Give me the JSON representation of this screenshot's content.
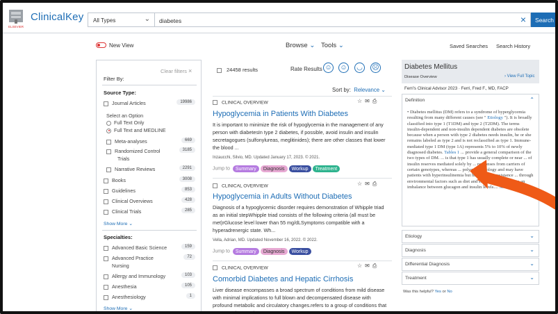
{
  "header": {
    "logo_text": "ClinicalKey",
    "logo_sub": "ELSEVIER",
    "type_select": "All Types",
    "search_value": "diabetes",
    "search_button": "Search"
  },
  "subnav": {
    "new_view": "New View",
    "browse": "Browse",
    "tools": "Tools",
    "saved_searches": "Saved Searches",
    "search_history": "Search History"
  },
  "filters": {
    "clear": "Clear filters",
    "filter_by": "Filter By:",
    "source_type_heading": "Source Type:",
    "journal": {
      "label": "Journal Articles",
      "count": "19986"
    },
    "select_option": "Select an Option",
    "radio_full_text": "Full Text Only",
    "radio_medline": "Full Text and MEDLINE",
    "meta": {
      "label": "Meta-analyses",
      "count": "669"
    },
    "rct_1": "Randomized Control",
    "rct_2": "Trials",
    "rct_count": "3185",
    "narrative": {
      "label": "Narrative Reviews",
      "count": "2291"
    },
    "books": {
      "label": "Books",
      "count": "3008"
    },
    "guidelines": {
      "label": "Guidelines",
      "count": "853"
    },
    "overviews": {
      "label": "Clinical Overviews",
      "count": "428"
    },
    "trials": {
      "label": "Clinical Trials",
      "count": "285"
    },
    "show_more": "Show More",
    "specialties_heading": "Specialties:",
    "abs": {
      "label": "Advanced Basic Science",
      "count": "159"
    },
    "practice_1": "Advanced Practice",
    "practice_2": "Nursing",
    "practice_count": "72",
    "allergy": {
      "label": "Allergy and Immunology",
      "count": "103"
    },
    "anesthesia": {
      "label": "Anesthesia",
      "count": "105"
    },
    "anesthesiology": {
      "label": "Anesthesiology",
      "count": "1"
    },
    "show_more_2": "Show More"
  },
  "results": {
    "count": "24458 results",
    "rate": "Rate Results",
    "sort_by": "Sort by:",
    "sort_value": "Relevance",
    "cards": [
      {
        "type": "CLINICAL OVERVIEW",
        "title": "Hypoglycemia in Patients With Diabetes",
        "text": "It is important to minimize the risk of hypoglycemia in the management of any person with diabetesIn type 2 diabetes, if possible, avoid insulin and insulin secretagogues (sulfonylureas, meglitinides); there are other classes that lower the blood ...",
        "meta": "Inzaucchi, Silvio, MD. Updated January 17, 2023. © 2021.",
        "jump": "Jump to",
        "pills": [
          "Summary",
          "Diagnosis",
          "Workup",
          "Treatment"
        ]
      },
      {
        "type": "CLINICAL OVERVIEW",
        "title": "Hypoglycemia in Adults Without Diabetes",
        "text": "Diagnosis of a hypoglycemic disorder requires demonstration of Whipple triad as an initial stepWhipple triad consists of the following criteria (all must be met)rGlucose level lower than 55 mg/dLSymptoms compatible with a hyperadrenergic state. Wh...",
        "meta": "Vella, Adrian, MD. Updated November 16, 2022. © 2022.",
        "jump": "Jump to",
        "pills": [
          "Summary",
          "Diagnosis",
          "Workup"
        ]
      },
      {
        "type": "CLINICAL OVERVIEW",
        "title": "Comorbid Diabetes and Hepatic Cirrhosis",
        "text": "Liver disease encompasses a broad spectrum of conditions from mild disease with minimal implications to full blown and decompensated disease with profound metabolic and circulatory changes.refers to a group of conditions that are strongly associat..."
      }
    ]
  },
  "sidebar": {
    "title": "Diabetes Mellitus",
    "overview": "Disease Overview",
    "view_full": "View Full Topic",
    "source": "Ferri's Clinical Advisor 2023 · Ferri, Fred F., MD, FACP",
    "definition": "Definition",
    "def_1": "• Diabetes mellitus (DM) refers to a syndrome of hyperglycemia resulting from many different causes (see \" ",
    "def_link1": "Etiology",
    "def_2": " \"). It is broadly classified into type 1 (T1DM) and type 2 (T2DM). The terms insulin-dependent and non-insulin dependent diabetes are obsolete because when a person with type 2 diabetes needs insulin, he or she remains labeled as type 2 and is not reclassified as type 1. Immune-mediated type 1 DM (type 1A) represents 5% to 10% of newly diagnosed diabetes. ",
    "def_link2": "Tables 1",
    "def_3": " ... provide a general comparison of the two types of DM. ... is that type 1 has usually complete or near ... of insulin reserves mediated solely by ... responses from carriers of certain genotypes, whereas ... polygenic etiology and may have patients with hyperinsulinemia but have insulin resistance ... through environmental factors such as diet and sed... lifestyle leads to an imbalance between glucagon and insulin levels.... ",
    "def_more": "More",
    "etiology": "Etiology",
    "diagnosis": "Diagnosis",
    "differential": "Differential Diagnosis",
    "treatment": "Treatment",
    "helpful": "Was this helpful?",
    "yes": "Yes",
    "or": " or ",
    "no": "No"
  },
  "colors": {
    "accent": "#1d6db5",
    "arrow": "#ef5a17",
    "summary": "#b57be0",
    "diagnosis": "#e7a9d3",
    "workup": "#3a4fa0",
    "treatment": "#2eb38e"
  }
}
